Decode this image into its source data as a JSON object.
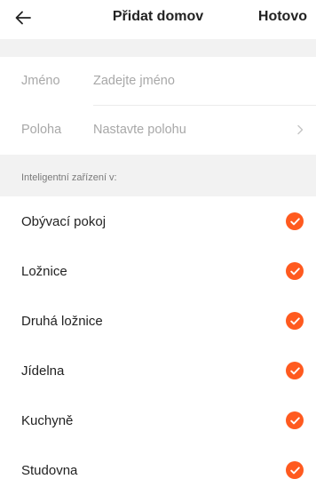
{
  "header": {
    "back_icon": "arrow-left-icon",
    "title": "Přidat domov",
    "done_label": "Hotovo"
  },
  "form": {
    "name_label": "Jméno",
    "name_placeholder": "Zadejte jméno",
    "location_label": "Poloha",
    "location_placeholder": "Nastavte polohu",
    "location_icon": "chevron-right-icon"
  },
  "section": {
    "title": "Inteligentní zařízení v:"
  },
  "rooms": [
    {
      "label": "Obývací pokoj",
      "checked": true
    },
    {
      "label": "Ložnice",
      "checked": true
    },
    {
      "label": "Druhá ložnice",
      "checked": true
    },
    {
      "label": "Jídelna",
      "checked": true
    },
    {
      "label": "Kuchyně",
      "checked": true
    },
    {
      "label": "Studovna",
      "checked": true
    }
  ],
  "colors": {
    "accent": "#ff5a1f",
    "section_bg": "#f2f2f2",
    "placeholder": "#a8a8a8"
  }
}
